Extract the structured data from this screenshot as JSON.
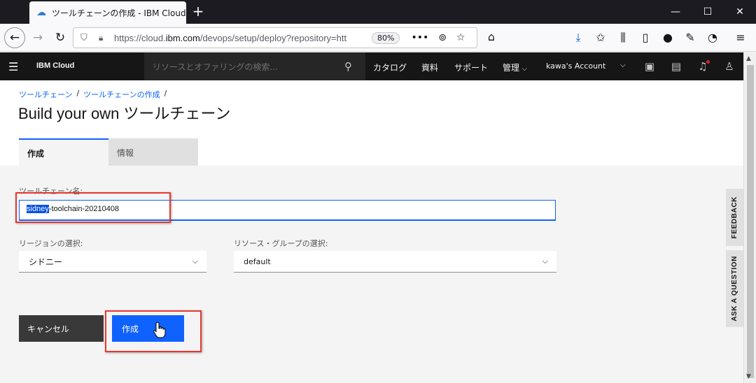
{
  "browser": {
    "tab_title": "ツールチェーンの作成 - IBM Cloud",
    "url_prefix": "https://cloud.",
    "url_domain": "ibm.com",
    "url_suffix": "/devops/setup/deploy?repository=htt",
    "zoom": "80%"
  },
  "header": {
    "brand": "IBM Cloud",
    "search_placeholder": "リソースとオファリングの検索...",
    "nav": [
      "カタログ",
      "資料",
      "サポート",
      "管理"
    ],
    "account": "kawa's Account"
  },
  "page": {
    "breadcrumb": [
      "ツールチェーン",
      "ツールチェーンの作成"
    ],
    "breadcrumb_sep": "/",
    "title": "Build your own ツールチェーン",
    "tabs": [
      "作成",
      "情報"
    ]
  },
  "form": {
    "name_label": "ツールチェーン名:",
    "name_selected": "sidney",
    "name_rest": "-toolchain-20210408",
    "region_label": "リージョンの選択:",
    "region_value": "シドニー",
    "group_label": "リソース・グループの選択:",
    "group_value": "default",
    "cancel_label": "キャンセル",
    "create_label": "作成"
  },
  "side_tabs": [
    "FEEDBACK",
    "ASK A QUESTION"
  ],
  "colors": {
    "accent": "#0f62fe",
    "highlight": "#e8372f"
  }
}
